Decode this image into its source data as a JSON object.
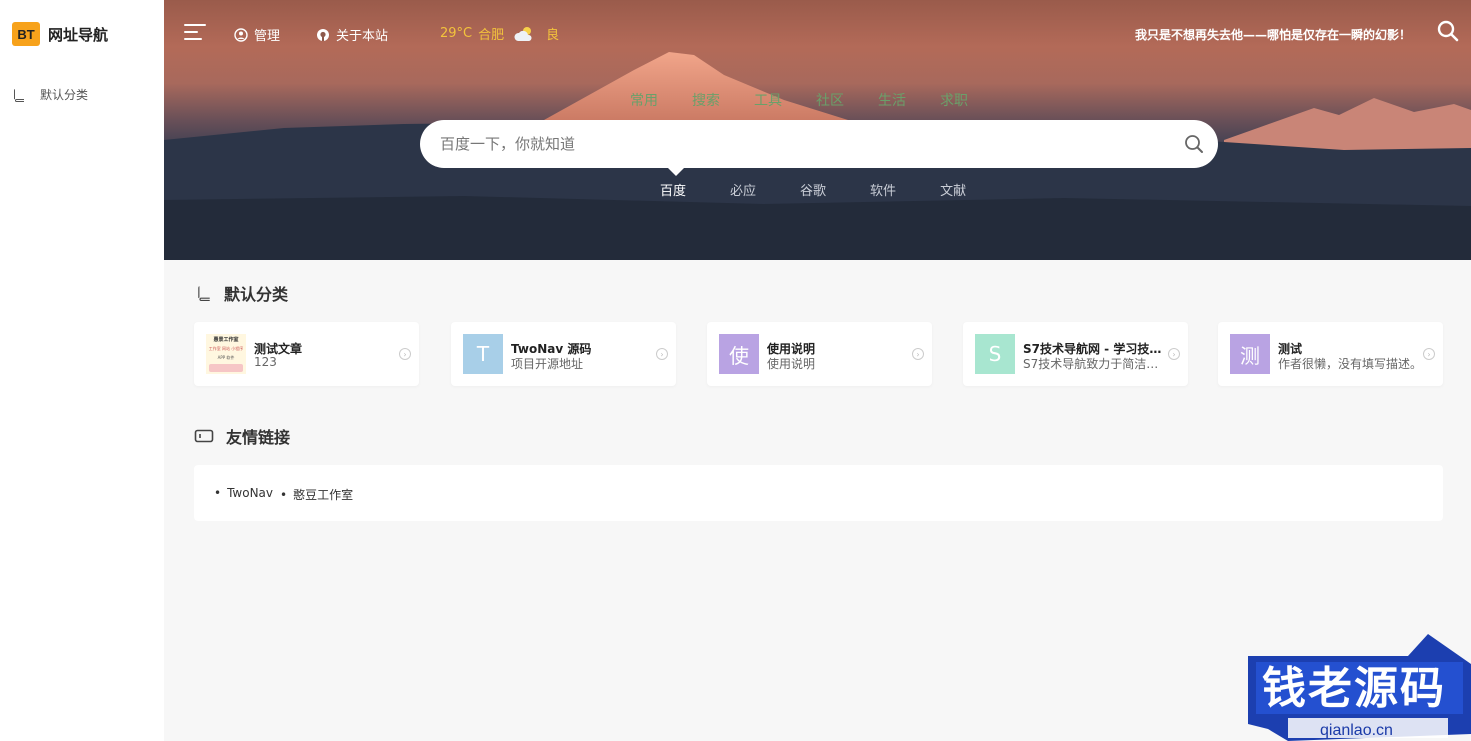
{
  "sidebar": {
    "logo_badge": "BT",
    "logo_text": "网址导航",
    "items": [
      {
        "label": "默认分类",
        "icon": "book-icon"
      }
    ]
  },
  "header": {
    "nav": [
      {
        "label": "管理",
        "icon": "user-circle-icon"
      },
      {
        "label": "关于本站",
        "icon": "github-icon"
      }
    ],
    "weather": {
      "temp": "29°C",
      "city": "合肥",
      "icon": "partly-cloudy-icon",
      "aqi": "良"
    },
    "motto": "我只是不想再失去他——哪怕是仅存在一瞬的幻影！",
    "categories": [
      "常用",
      "搜索",
      "工具",
      "社区",
      "生活",
      "求职"
    ],
    "search": {
      "placeholder": "百度一下，你就知道"
    },
    "engines": [
      "百度",
      "必应",
      "谷歌",
      "软件",
      "文献"
    ],
    "active_engine": "百度"
  },
  "main": {
    "section1_title": "默认分类",
    "cards": [
      {
        "name": "测试文章",
        "desc": "123",
        "thumb": "",
        "color": "#ffffff"
      },
      {
        "name": "TwoNav 源码",
        "desc": "项目开源地址",
        "thumb": "T",
        "color": "#a8cfe8"
      },
      {
        "name": "使用说明",
        "desc": "使用说明",
        "thumb": "使",
        "color": "#b9a3e3"
      },
      {
        "name": "S7技术导航网 - 学习技…",
        "desc": "S7技术导航致力于简洁高…",
        "thumb": "S",
        "color": "#a8e6d0"
      },
      {
        "name": "测试",
        "desc": "作者很懒，没有填写描述。",
        "thumb": "测",
        "color": "#b9a3e3"
      }
    ],
    "thumb_image_text": [
      "惠景工作室",
      "工作室 网站 小程序",
      "APP 软件"
    ],
    "section2_title": "友情链接",
    "links": [
      "TwoNav",
      "憨豆工作室"
    ]
  },
  "watermark": {
    "text": "钱老源码",
    "sub": "qianlao.cn"
  },
  "colors": {
    "accent": "#f7a21b",
    "weather": "#f3c33c",
    "watermark_blue": "#1c3fb0"
  }
}
